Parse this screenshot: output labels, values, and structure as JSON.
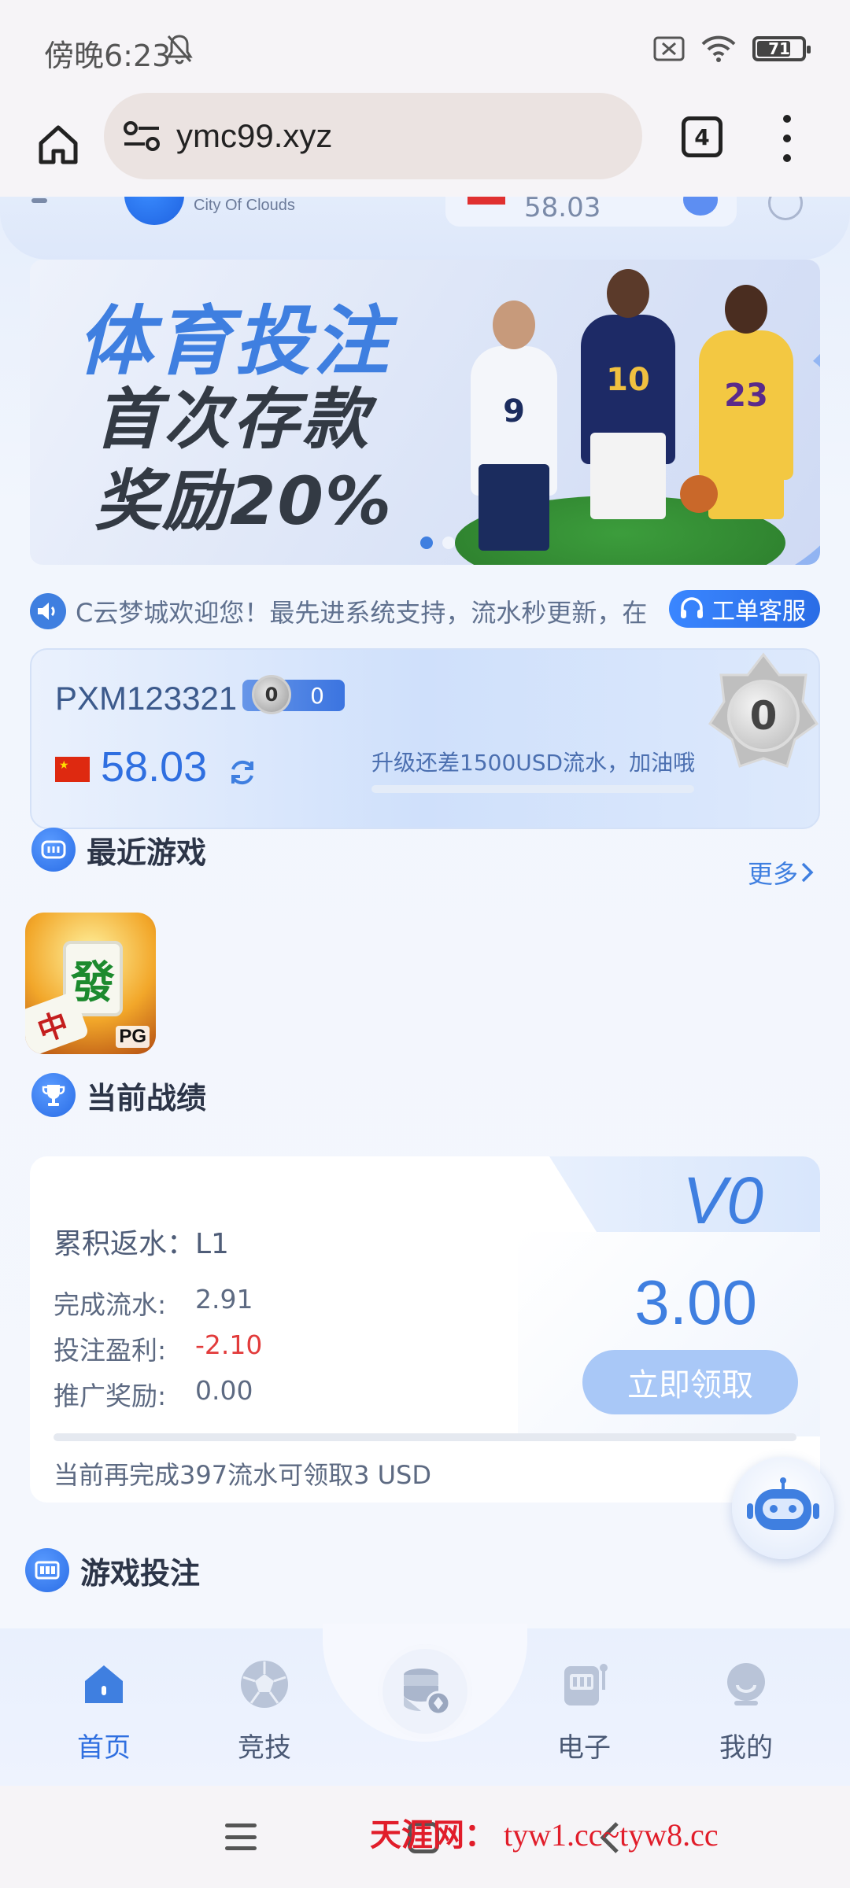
{
  "status_bar": {
    "time": "傍晚6:23",
    "battery": "71"
  },
  "browser": {
    "url": "ymc99.xyz",
    "tab_count": "4"
  },
  "site_header": {
    "logo_subtitle": "City Of Clouds",
    "balance": "58.03"
  },
  "banner": {
    "line1": "体育投注",
    "line2": "首次存款",
    "line3": "奖励20%",
    "player_numbers": [
      "9",
      "10",
      "23"
    ]
  },
  "marquee": {
    "text": "C云梦城欢迎您！最先进系统支持，流水秒更新，在",
    "support_label": "工单客服"
  },
  "user_card": {
    "username": "PXM123321",
    "vip_level": "0",
    "vip_points": "0",
    "currency_flag": "CN",
    "balance": "58.03",
    "upgrade_text": "升级还差1500USD流水，加油哦",
    "upgrade_progress_percent": 0,
    "medal_level": "0"
  },
  "recent_games": {
    "title": "最近游戏",
    "more_label": "更多",
    "games": [
      {
        "provider": "PG",
        "tile_main": "發",
        "tile_second": "中"
      }
    ]
  },
  "current_record": {
    "title": "当前战绩",
    "vip_tag": "V0",
    "cumulative_rebate": "累积返水：L1",
    "rows": [
      {
        "label": "完成流水:",
        "value": "2.91"
      },
      {
        "label": "投注盈利:",
        "value": "-2.10"
      },
      {
        "label": "推广奖励:",
        "value": "0.00"
      }
    ],
    "reward_amount": "3.00",
    "claim_label": "立即领取",
    "progress_percent": 0,
    "note": "当前再完成397流水可领取3 USD"
  },
  "game_betting": {
    "title": "游戏投注"
  },
  "bottom_nav": {
    "items": [
      {
        "label": "首页",
        "active": true
      },
      {
        "label": "竞技",
        "active": false
      },
      {
        "label": "电子",
        "active": false
      },
      {
        "label": "我的",
        "active": false
      }
    ]
  },
  "watermark": {
    "part1": "天涯网：",
    "part2": "tyw1.cc~tyw8.cc"
  },
  "colors": {
    "primary": "#3f7fe0",
    "negative": "#e23b3b",
    "claim_button": "#a9c8f7"
  }
}
